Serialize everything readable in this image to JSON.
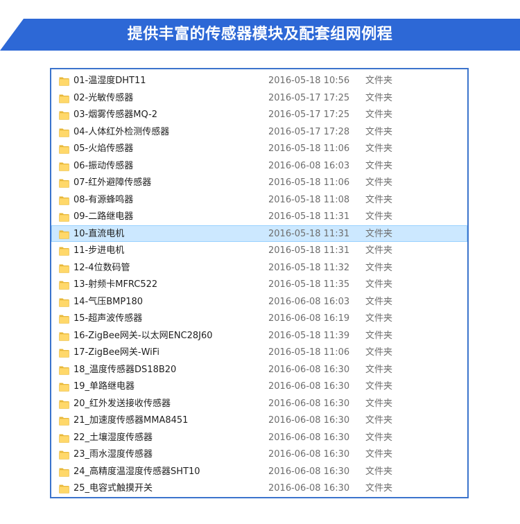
{
  "banner": {
    "title": "提供丰富的传感器模块及配套组网例程",
    "color": "#2d68d6"
  },
  "explorer": {
    "selected_index": 9,
    "folder_color": "#ffd86a",
    "folder_tab_color": "#e8b83a",
    "items": [
      {
        "name": "01-温湿度DHT11",
        "date": "2016-05-18 10:56",
        "type": "文件夹"
      },
      {
        "name": "02-光敏传感器",
        "date": "2016-05-17 17:25",
        "type": "文件夹"
      },
      {
        "name": "03-烟雾传感器MQ-2",
        "date": "2016-05-17 17:25",
        "type": "文件夹"
      },
      {
        "name": "04-人体红外检测传感器",
        "date": "2016-05-17 17:28",
        "type": "文件夹"
      },
      {
        "name": "05-火焰传感器",
        "date": "2016-05-18 11:06",
        "type": "文件夹"
      },
      {
        "name": "06-振动传感器",
        "date": "2016-06-08 16:03",
        "type": "文件夹"
      },
      {
        "name": "07-红外避障传感器",
        "date": "2016-05-18 11:06",
        "type": "文件夹"
      },
      {
        "name": "08-有源蜂鸣器",
        "date": "2016-05-18 11:08",
        "type": "文件夹"
      },
      {
        "name": "09-二路继电器",
        "date": "2016-05-18 11:31",
        "type": "文件夹"
      },
      {
        "name": "10-直流电机",
        "date": "2016-05-18 11:31",
        "type": "文件夹"
      },
      {
        "name": "11-步进电机",
        "date": "2016-05-18 11:31",
        "type": "文件夹"
      },
      {
        "name": "12-4位数码管",
        "date": "2016-05-18 11:32",
        "type": "文件夹"
      },
      {
        "name": "13-射频卡MFRC522",
        "date": "2016-05-18 11:35",
        "type": "文件夹"
      },
      {
        "name": "14-气压BMP180",
        "date": "2016-06-08 16:03",
        "type": "文件夹"
      },
      {
        "name": "15-超声波传感器",
        "date": "2016-06-08 16:19",
        "type": "文件夹"
      },
      {
        "name": "16-ZigBee网关-以太网ENC28J60",
        "date": "2016-05-18 11:39",
        "type": "文件夹"
      },
      {
        "name": "17-ZigBee网关-WiFi",
        "date": "2016-05-18 11:06",
        "type": "文件夹"
      },
      {
        "name": "18_温度传感器DS18B20",
        "date": "2016-06-08 16:30",
        "type": "文件夹"
      },
      {
        "name": "19_单路继电器",
        "date": "2016-06-08 16:30",
        "type": "文件夹"
      },
      {
        "name": "20_红外发送接收传感器",
        "date": "2016-06-08 16:30",
        "type": "文件夹"
      },
      {
        "name": "21_加速度传感器MMA8451",
        "date": "2016-06-08 16:30",
        "type": "文件夹"
      },
      {
        "name": "22_土壤湿度传感器",
        "date": "2016-06-08 16:30",
        "type": "文件夹"
      },
      {
        "name": "23_雨水湿度传感器",
        "date": "2016-06-08 16:30",
        "type": "文件夹"
      },
      {
        "name": "24_高精度温湿度传感器SHT10",
        "date": "2016-06-08 16:30",
        "type": "文件夹"
      },
      {
        "name": "25_电容式触摸开关",
        "date": "2016-06-08 16:30",
        "type": "文件夹"
      }
    ]
  }
}
